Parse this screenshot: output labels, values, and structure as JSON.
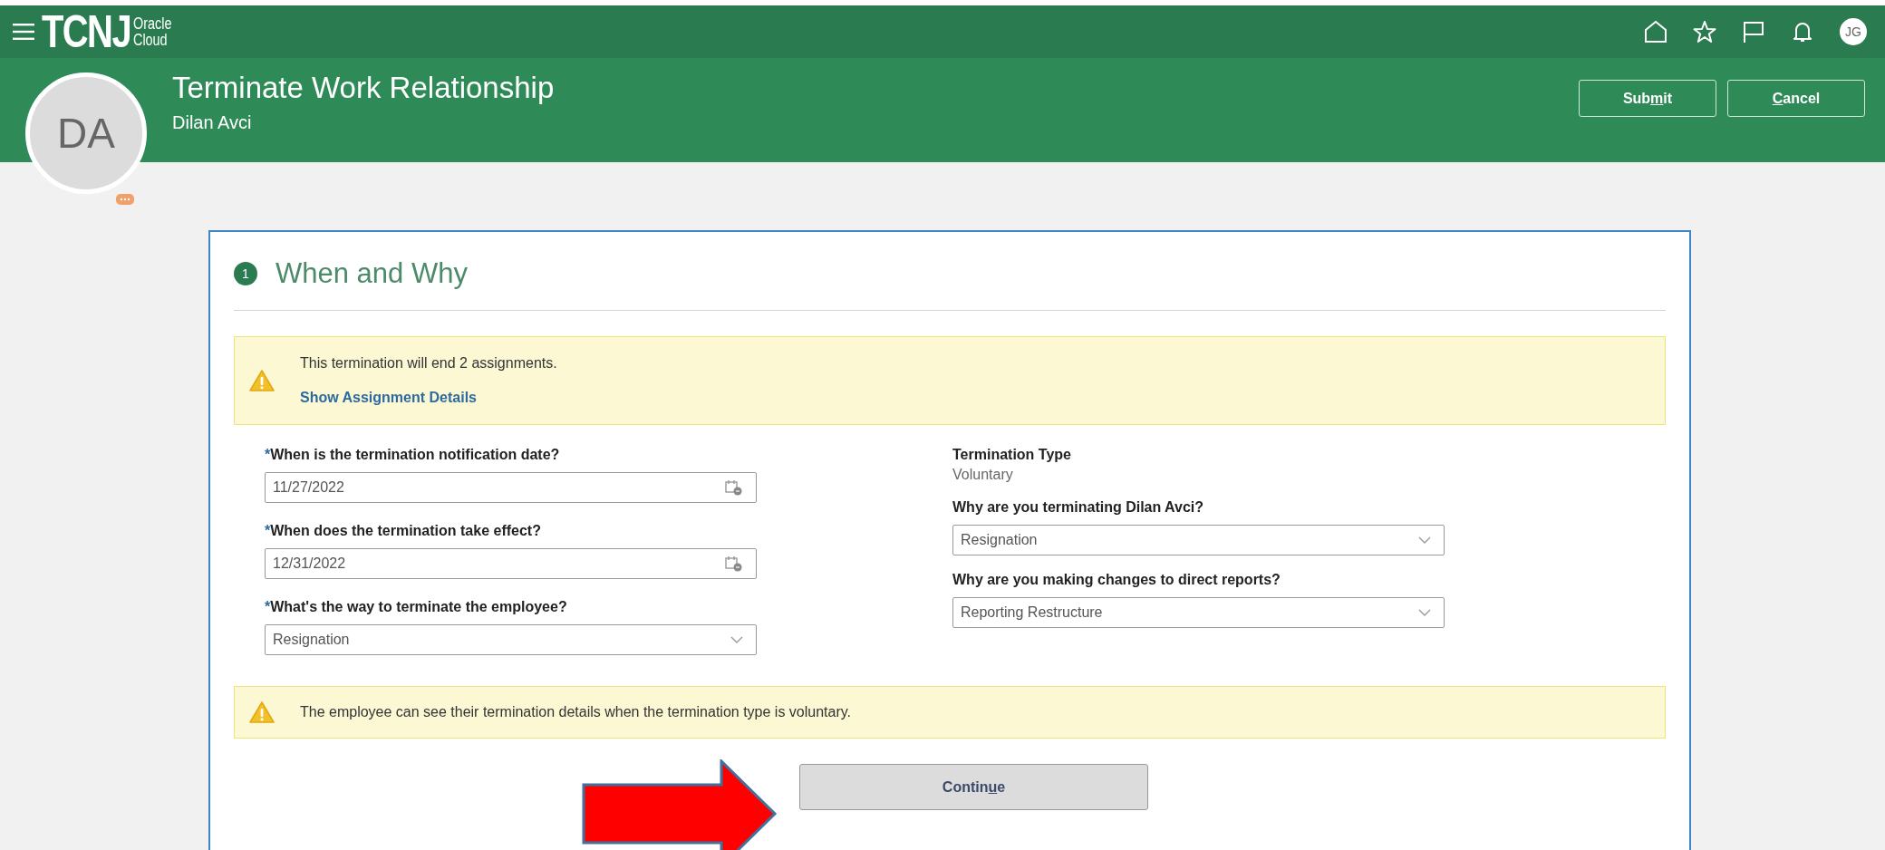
{
  "app_bar": {
    "logo": "TCNJ",
    "logo_sub": [
      "Oracle",
      "Cloud"
    ],
    "user_initials": "JG"
  },
  "page_header": {
    "title": "Terminate Work Relationship",
    "subtitle": "Dilan Avci",
    "avatar_initials": "DA",
    "buttons": [
      {
        "label_before": "Sub",
        "access_key": "m",
        "label_after": "it"
      },
      {
        "access_key": "C",
        "label_after": "ancel"
      }
    ]
  },
  "section": {
    "step": "1",
    "title": "When and Why"
  },
  "assignment_alert": {
    "message": "This termination will end 2 assignments.",
    "link": "Show Assignment Details"
  },
  "left_fields": [
    {
      "kind": "date",
      "required_mark": "*",
      "label": "When is the termination notification date?",
      "value": "11/27/2022"
    },
    {
      "kind": "date",
      "required_mark": "*",
      "label": "When does the termination take effect?",
      "value": "12/31/2022"
    },
    {
      "kind": "select",
      "required_mark": "*",
      "label": "What's the way to terminate the employee?",
      "value": "Resignation"
    }
  ],
  "termination_type": {
    "label": "Termination Type",
    "value": "Voluntary"
  },
  "right_fields": [
    {
      "kind": "select",
      "label": "Why are you terminating Dilan Avci?",
      "value": "Resignation"
    },
    {
      "kind": "select",
      "label": "Why are you making changes to direct reports?",
      "value": "Reporting Restructure"
    }
  ],
  "visibility_alert": {
    "message": "The employee can see their termination details when the termination type is voluntary."
  },
  "continue_button": {
    "label_before": "Contin",
    "access_key": "u",
    "label_after": "e"
  }
}
